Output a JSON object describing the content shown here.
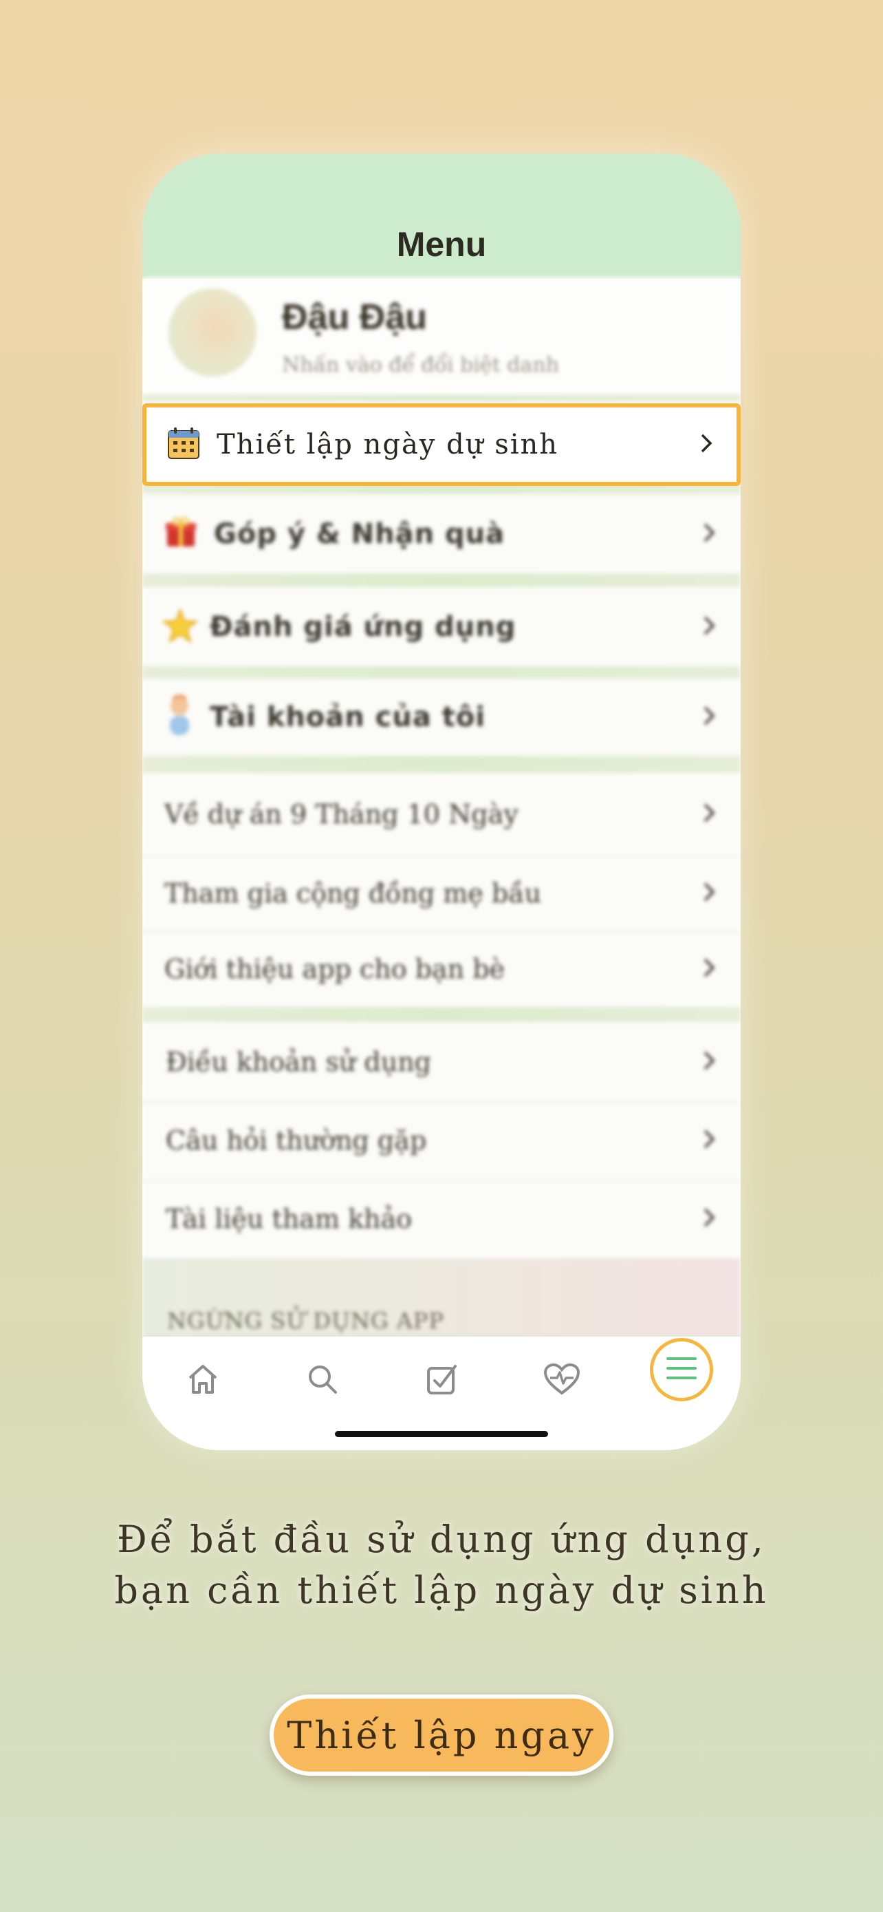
{
  "menu": {
    "title": "Menu",
    "profile": {
      "name": "Đậu Đậu",
      "hint": "Nhấn vào để đổi biệt danh"
    },
    "highlighted_item": {
      "label": "Thiết lập ngày dự sinh",
      "icon": "calendar-icon"
    },
    "main_items": [
      {
        "label": "Góp ý & Nhận quà",
        "icon": "gift-icon"
      },
      {
        "label": "Đánh giá ứng dụng",
        "icon": "star-icon"
      },
      {
        "label": "Tài khoản của tôi",
        "icon": "baby-avatar-icon"
      }
    ],
    "info_items": [
      {
        "label": "Về dự án 9 Tháng 10 Ngày"
      },
      {
        "label": "Tham gia cộng đồng mẹ bầu"
      },
      {
        "label": "Giới thiệu app cho bạn bè"
      }
    ],
    "legal_items": [
      {
        "label": "Điều khoản sử dụng"
      },
      {
        "label": "Câu hỏi thường gặp"
      },
      {
        "label": "Tài liệu tham khảo"
      }
    ],
    "stop_section_label": "NGỪNG SỬ DỤNG APP"
  },
  "tabbar": {
    "tabs": [
      {
        "icon": "home-icon"
      },
      {
        "icon": "search-icon"
      },
      {
        "icon": "checklist-icon"
      },
      {
        "icon": "heart-pulse-icon"
      },
      {
        "icon": "menu-icon",
        "active": true
      }
    ]
  },
  "onboarding": {
    "caption_line1": "Để bắt đầu sử dụng ứng dụng,",
    "caption_line2": "bạn cần thiết lập ngày dự sinh",
    "cta_label": "Thiết lập ngay"
  },
  "colors": {
    "accent": "#f8b53e",
    "header_green": "#cdeccd",
    "cta_fill": "#f8b85c"
  }
}
